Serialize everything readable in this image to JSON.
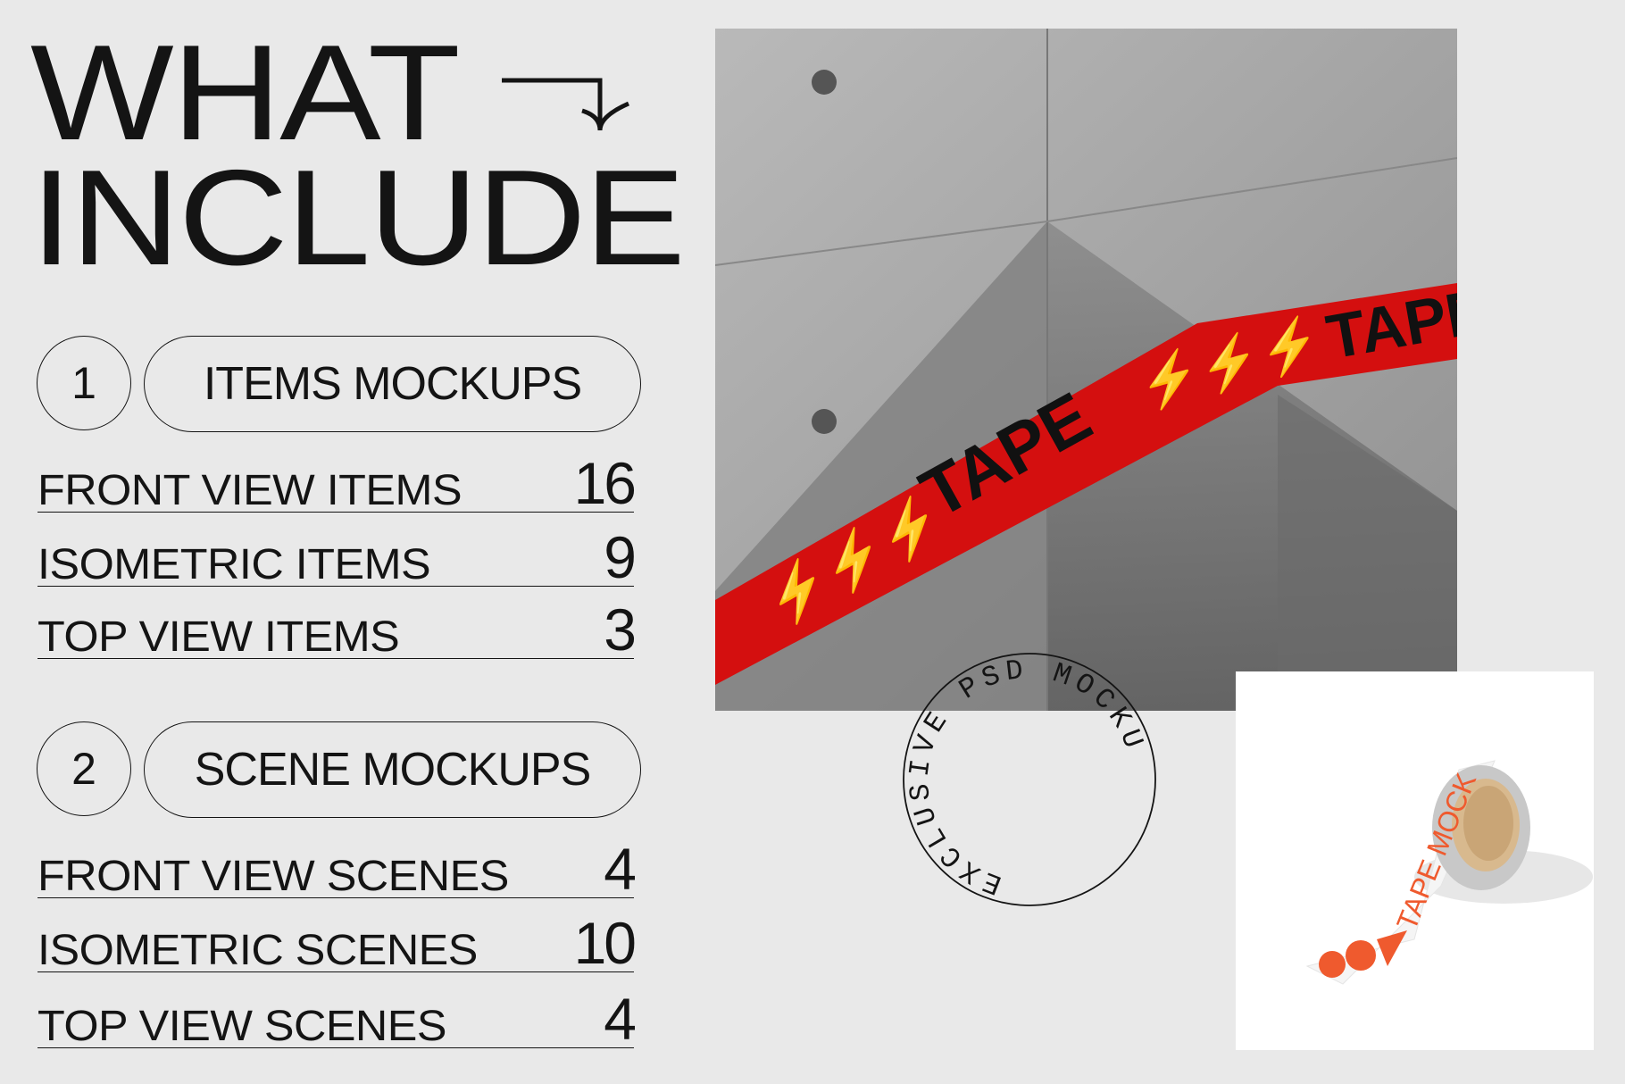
{
  "heading": {
    "line1": "WHAT",
    "line2": "INCLUDE",
    "arrow_icon": "arrow-right-down-icon"
  },
  "sections": [
    {
      "number": "1",
      "title": "ITEMS MOCKUPS",
      "rows": [
        {
          "label": "FRONT VIEW ITEMS",
          "count": "16"
        },
        {
          "label": "ISOMETRIC ITEMS",
          "count": "9"
        },
        {
          "label": "TOP VIEW ITEMS",
          "count": "3"
        }
      ]
    },
    {
      "number": "2",
      "title": "SCENE MOCKUPS",
      "rows": [
        {
          "label": "FRONT VIEW SCENES",
          "count": "4"
        },
        {
          "label": "ISOMETRIC SCENES",
          "count": "10"
        },
        {
          "label": "TOP VIEW SCENES",
          "count": "4"
        }
      ]
    }
  ],
  "photo": {
    "tape_text": "TAPE",
    "tape_color": "#d40f0f"
  },
  "stamp": {
    "text": "EXCLUSIVE PSD MOCKU"
  },
  "product": {
    "tape_text": "TAPE MOCK",
    "accent": "#ef5a2e"
  }
}
